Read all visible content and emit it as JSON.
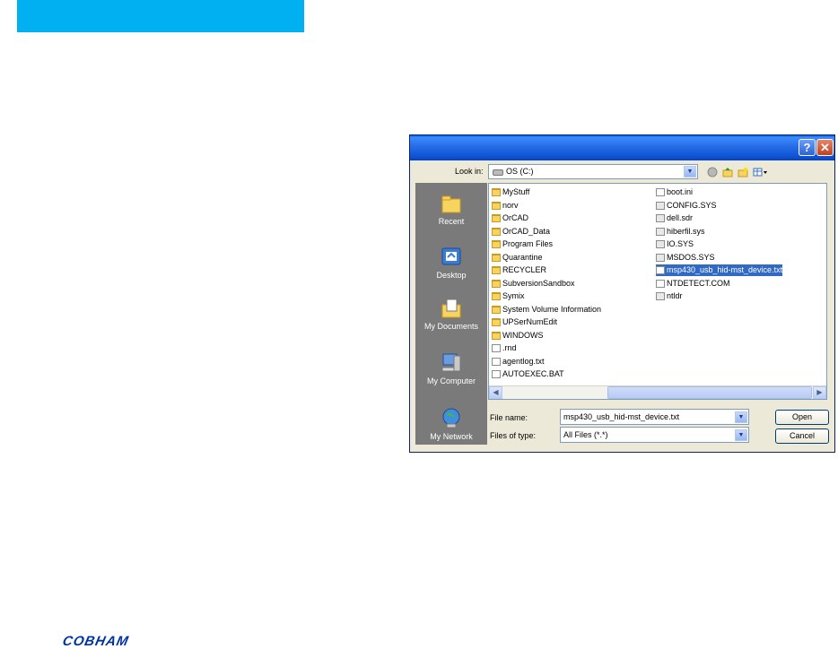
{
  "dialog": {
    "help_glyph": "?",
    "close_glyph": "✕",
    "look_in_label": "Look in:",
    "look_in_value": "OS (C:)",
    "places": [
      {
        "label": "Recent",
        "icon": "recent-folder-icon"
      },
      {
        "label": "Desktop",
        "icon": "desktop-icon"
      },
      {
        "label": "My Documents",
        "icon": "my-documents-icon"
      },
      {
        "label": "My Computer",
        "icon": "my-computer-icon"
      },
      {
        "label": "My Network",
        "icon": "my-network-icon"
      }
    ],
    "files_col1": [
      {
        "name": "MyStuff",
        "type": "folder"
      },
      {
        "name": "norv",
        "type": "folder"
      },
      {
        "name": "OrCAD",
        "type": "folder"
      },
      {
        "name": "OrCAD_Data",
        "type": "folder"
      },
      {
        "name": "Program Files",
        "type": "folder"
      },
      {
        "name": "Quarantine",
        "type": "folder"
      },
      {
        "name": "RECYCLER",
        "type": "folder"
      },
      {
        "name": "SubversionSandbox",
        "type": "folder"
      },
      {
        "name": "Symix",
        "type": "folder"
      },
      {
        "name": "System Volume Information",
        "type": "folder"
      },
      {
        "name": "UPSerNumEdit",
        "type": "folder"
      },
      {
        "name": "WINDOWS",
        "type": "folder"
      },
      {
        "name": ".rnd",
        "type": "file"
      },
      {
        "name": "agentlog.txt",
        "type": "file"
      },
      {
        "name": "AUTOEXEC.BAT",
        "type": "file"
      }
    ],
    "files_col2": [
      {
        "name": "boot.ini",
        "type": "file"
      },
      {
        "name": "CONFIG.SYS",
        "type": "sysfile"
      },
      {
        "name": "dell.sdr",
        "type": "sysfile"
      },
      {
        "name": "hiberfil.sys",
        "type": "sysfile"
      },
      {
        "name": "IO.SYS",
        "type": "sysfile"
      },
      {
        "name": "MSDOS.SYS",
        "type": "sysfile"
      },
      {
        "name": "msp430_usb_hid-mst_device.txt",
        "type": "file",
        "selected": true
      },
      {
        "name": "NTDETECT.COM",
        "type": "file"
      },
      {
        "name": "ntldr",
        "type": "sysfile"
      }
    ],
    "file_name_label": "File name:",
    "file_name_value": "msp430_usb_hid-mst_device.txt",
    "file_type_label": "Files of type:",
    "file_type_value": "All Files (*.*)",
    "open_label": "Open",
    "cancel_label": "Cancel"
  },
  "colors": {
    "top_bar": "#00b0f0",
    "logo": "#0033a1",
    "selection": "#316ac5"
  },
  "brand": {
    "logo_text": "COBHAM"
  }
}
